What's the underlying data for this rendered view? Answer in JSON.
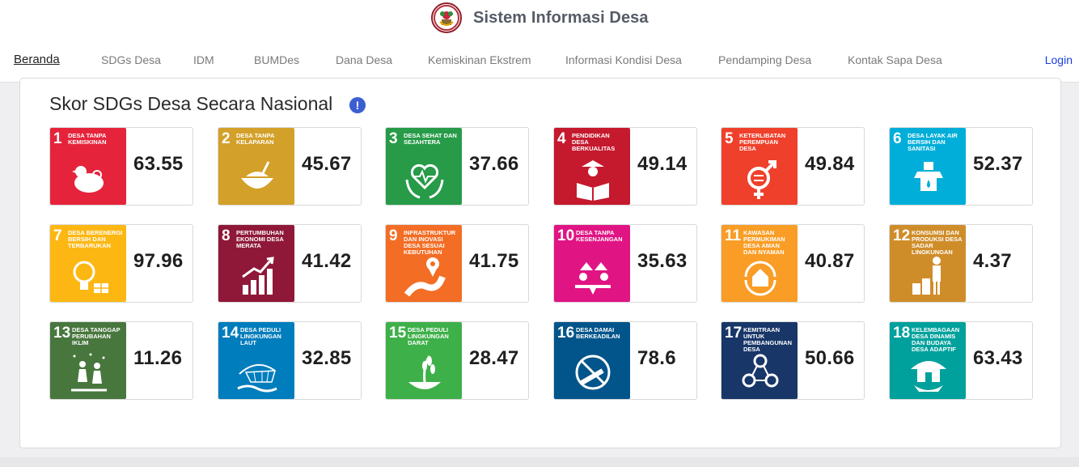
{
  "header": {
    "title": "Sistem Informasi Desa",
    "logo_icon": "village-emblem-icon"
  },
  "nav": {
    "items": [
      {
        "label": "Beranda",
        "active": true
      },
      {
        "label": "SDGs Desa"
      },
      {
        "label": "IDM"
      },
      {
        "label": "BUMDes"
      },
      {
        "label": "Dana Desa"
      },
      {
        "label": "Kemiskinan Ekstrem"
      },
      {
        "label": "Informasi Kondisi Desa"
      },
      {
        "label": "Pendamping Desa"
      },
      {
        "label": "Kontak Sapa Desa"
      }
    ],
    "login_label": "Login"
  },
  "panel": {
    "title": "Skor SDGs Desa Secara Nasional",
    "info_icon": "!"
  },
  "goals": [
    {
      "num": "1",
      "label": "Desa Tanpa Kemiskinan",
      "score": "63.55",
      "color": "#e5243b",
      "icon": "hen-icon"
    },
    {
      "num": "2",
      "label": "Desa Tanpa Kelaparan",
      "score": "45.67",
      "color": "#d3a029",
      "icon": "bowl-icon"
    },
    {
      "num": "3",
      "label": "Desa Sehat dan Sejahtera",
      "score": "37.66",
      "color": "#279b48",
      "icon": "heart-hands-icon"
    },
    {
      "num": "4",
      "label": "Pendidikan Desa Berkualitas",
      "score": "49.14",
      "color": "#c5192d",
      "icon": "reader-icon"
    },
    {
      "num": "5",
      "label": "Keterlibatan Perempuan Desa",
      "score": "49.84",
      "color": "#ef402b",
      "icon": "gender-icon"
    },
    {
      "num": "6",
      "label": "Desa Layak Air Bersih dan Sanitasi",
      "score": "52.37",
      "color": "#00aed9",
      "icon": "water-vessel-icon"
    },
    {
      "num": "7",
      "label": "Desa Berenergi Bersih dan Terbarukan",
      "score": "97.96",
      "color": "#fdb713",
      "icon": "lightbulb-icon"
    },
    {
      "num": "8",
      "label": "Pertumbuhan Ekonomi Desa Merata",
      "score": "41.42",
      "color": "#8f1838",
      "icon": "growth-chart-icon"
    },
    {
      "num": "9",
      "label": "Infrastruktur dan Inovasi Desa Sesuai Kebutuhan",
      "score": "41.75",
      "color": "#f36d25",
      "icon": "road-pin-icon"
    },
    {
      "num": "10",
      "label": "Desa Tanpa Kesenjangan",
      "score": "35.63",
      "color": "#e11484",
      "icon": "balance-icon"
    },
    {
      "num": "11",
      "label": "Kawasan Permukiman Desa Aman dan Nyaman",
      "score": "40.87",
      "color": "#f99d26",
      "icon": "house-cycle-icon"
    },
    {
      "num": "12",
      "label": "Konsumsi dan Produksi Desa Sadar Lingkungan",
      "score": "4.37",
      "color": "#cf8d2a",
      "icon": "farmer-icon"
    },
    {
      "num": "13",
      "label": "Desa Tanggap Perubahan Iklim",
      "score": "11.26",
      "color": "#48773e",
      "icon": "rain-people-icon"
    },
    {
      "num": "14",
      "label": "Desa Peduli Lingkungan Laut",
      "score": "32.85",
      "color": "#007dbc",
      "icon": "fishing-net-icon"
    },
    {
      "num": "15",
      "label": "Desa Peduli Lingkungan Darat",
      "score": "28.47",
      "color": "#3eb049",
      "icon": "rice-plant-icon"
    },
    {
      "num": "16",
      "label": "Desa Damai Berkeadilan",
      "score": "78.6",
      "color": "#02558b",
      "icon": "no-weapon-icon"
    },
    {
      "num": "17",
      "label": "Kemitraan untuk Pembangunan Desa",
      "score": "50.66",
      "color": "#183668",
      "icon": "network-people-icon"
    },
    {
      "num": "18",
      "label": "Kelembagaan Desa Dinamis dan Budaya Desa Adaptif",
      "score": "63.43",
      "color": "#00a19c",
      "icon": "traditional-house-icon"
    }
  ]
}
